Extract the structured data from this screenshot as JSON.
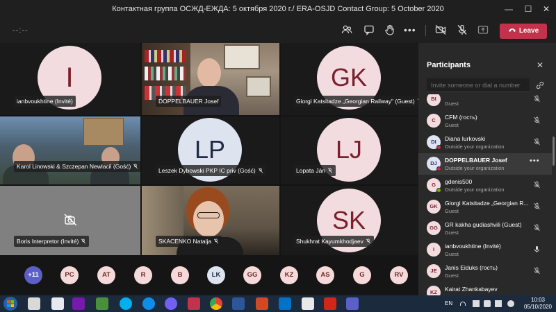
{
  "window": {
    "title": "Контактная группа ОСЖД-ЕЖДА: 5 октября 2020 г./ ERA-OSJD Contact Group: 5 October 2020",
    "minimize": "—",
    "maximize": "☐",
    "close": "✕"
  },
  "toolbar": {
    "timer": "--:--",
    "leave_label": "Leave",
    "leave_color": "#c4314b"
  },
  "tiles": [
    {
      "initials": "I",
      "name": "ianbvoukhtine (Invité)"
    },
    {
      "name": "DOPPELBAUER Josef"
    },
    {
      "initials": "GK",
      "name": "Giorgi Katsitadze „Georgian Railway\" (Guest)"
    },
    {
      "name": "Karol Linowski & Szczepan Newlacil (Gość)"
    },
    {
      "initials": "LP",
      "name": "Leszek Dybowski PKP IC priv (Gość)"
    },
    {
      "initials": "LJ",
      "name": "Lopata Ján"
    },
    {
      "name": "Boris Interpretor (Invité)"
    },
    {
      "name": "SKACENKO Natalja"
    },
    {
      "initials": "SK",
      "name": "Shukhrat Kayumkhodjaev"
    }
  ],
  "strip": {
    "more": "+11",
    "chips": [
      "PC",
      "AT",
      "R",
      "B",
      "LK",
      "GG",
      "KZ",
      "AS",
      "G",
      "RV"
    ]
  },
  "participants": {
    "title": "Participants",
    "close": "✕",
    "invite_placeholder": "Invite someone or dial a number",
    "list": [
      {
        "initials": "BI",
        "name": "",
        "sub": "Guest"
      },
      {
        "initials": "C",
        "name": "CFM (гость)",
        "sub": "Guest"
      },
      {
        "initials": "DI",
        "name": "Diana Iurkovski",
        "sub": "Outside your organization"
      },
      {
        "initials": "DJ",
        "name": "DOPPELBAUER Josef",
        "sub": "Outside your organization"
      },
      {
        "initials": "G",
        "name": "gdenis500",
        "sub": "Outside your organization"
      },
      {
        "initials": "GK",
        "name": "Giorgi Katsitadze „Georgian R...",
        "sub": "Guest"
      },
      {
        "initials": "GG",
        "name": "GR kakha gudiashvili (Guest)",
        "sub": "Guest"
      },
      {
        "initials": "I",
        "name": "ianbvoukhtine (Invité)",
        "sub": "Guest"
      },
      {
        "initials": "JE",
        "name": "Janis Eiduks (гость)",
        "sub": "Guest"
      },
      {
        "initials": "KZ",
        "name": "Kairat Zhankabayev",
        "sub": ""
      }
    ]
  },
  "taskbar": {
    "lang": "EN",
    "time": "10:03",
    "date": "05/10/2020"
  }
}
